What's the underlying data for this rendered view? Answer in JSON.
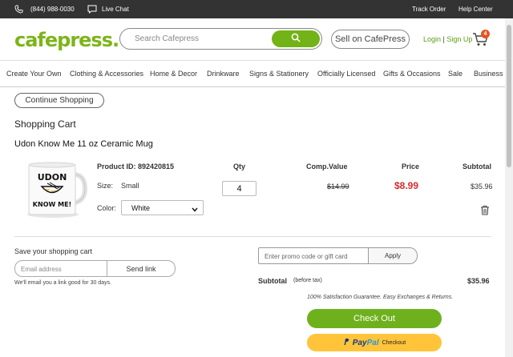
{
  "topbar": {
    "phone": "(844) 988-0030",
    "live_chat": "Live Chat",
    "track_order": "Track Order",
    "help_center": "Help Center"
  },
  "header": {
    "logo": "cafepress",
    "search_placeholder": "Search Cafepress",
    "sell": "Sell on CafePress",
    "login": "Login",
    "separator": "|",
    "signup": "Sign Up",
    "cart_count": "4",
    "brand_color": "#7cb518"
  },
  "nav": {
    "items": [
      "Create Your Own",
      "Clothing & Accessories",
      "Home & Decor",
      "Drinkware",
      "Signs & Stationery",
      "Officially Licensed",
      "Gifts & Occasions",
      "Sale",
      "Business"
    ]
  },
  "cart": {
    "continue": "Continue Shopping",
    "title": "Shopping Cart",
    "product_name": "Udon Know Me 11 oz Ceramic Mug",
    "product_id_label": "Product ID: 892420815",
    "mug_text_top": "UDON",
    "mug_text_bottom": "KNOW ME!",
    "size_label": "Size:",
    "size_value": "Small",
    "color_label": "Color:",
    "color_value": "White",
    "col_qty": "Qty",
    "col_comp": "Comp.Value",
    "col_price": "Price",
    "col_subtotal": "Subtotal",
    "qty": "4",
    "comp_value": "$14.99",
    "price": "$8.99",
    "line_subtotal": "$35.96",
    "price_color": "#d62d2d"
  },
  "save_cart": {
    "title": "Save your shopping cart",
    "email_placeholder": "Email address",
    "send": "Send link",
    "note": "We'll email you a link good for 30 days."
  },
  "summary": {
    "promo_placeholder": "Enter promo code or gift card",
    "apply": "Apply",
    "subtotal_label": "Subtotal",
    "before_tax": "(before tax)",
    "subtotal": "$35.96",
    "guarantee": "100% Satisfaction Guarantee. Easy Exchanges & Returns.",
    "checkout": "Check Out",
    "paypal_pay": "Pay",
    "paypal_pal": "Pal",
    "paypal_checkout": "Checkout"
  }
}
